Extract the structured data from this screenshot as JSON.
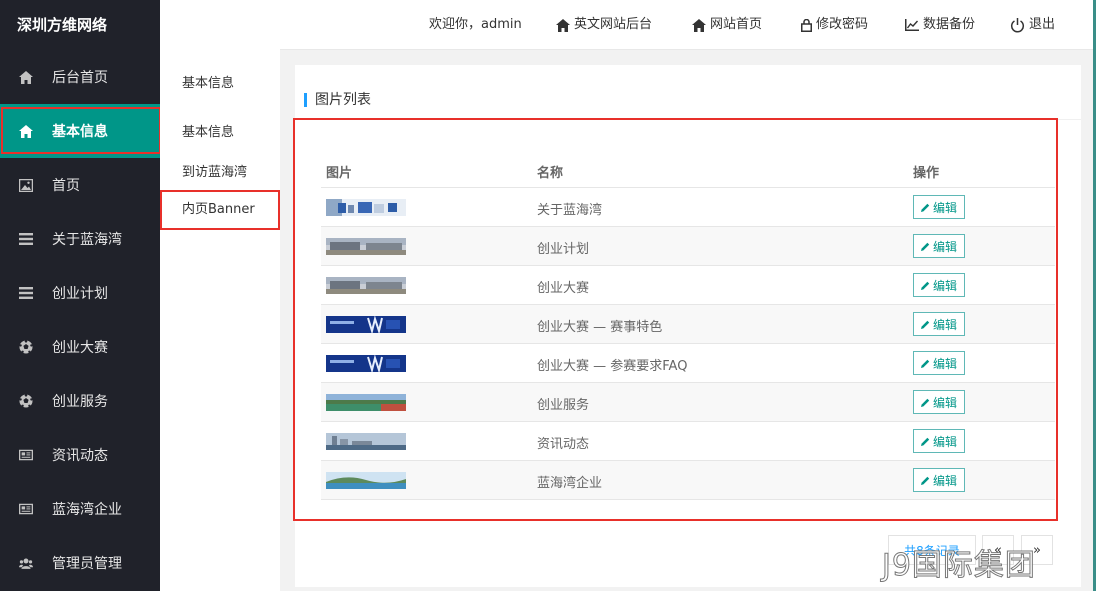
{
  "app": {
    "logo": "深圳方维网络"
  },
  "sidebar": {
    "items": [
      {
        "label": "后台首页",
        "icon": "home-icon"
      },
      {
        "label": "基本信息",
        "icon": "home-icon",
        "active": true
      },
      {
        "label": "首页",
        "icon": "picture-icon"
      },
      {
        "label": "关于蓝海湾",
        "icon": "menu-lines-icon"
      },
      {
        "label": "创业计划",
        "icon": "menu-lines-icon"
      },
      {
        "label": "创业大赛",
        "icon": "soccer-ball-icon"
      },
      {
        "label": "创业服务",
        "icon": "soccer-ball-icon"
      },
      {
        "label": "资讯动态",
        "icon": "newspaper-icon"
      },
      {
        "label": "蓝海湾企业",
        "icon": "newspaper-icon"
      },
      {
        "label": "管理员管理",
        "icon": "users-icon"
      }
    ]
  },
  "subnav": {
    "title": "基本信息",
    "items": [
      "基本信息",
      "到访蓝海湾",
      "内页Banner"
    ],
    "active_index": 2
  },
  "header": {
    "welcome": "欢迎你，admin",
    "links": {
      "english_admin": "英文网站后台",
      "site_home": "网站首页",
      "change_password": "修改密码",
      "data_backup": "数据备份",
      "logout": "退出"
    }
  },
  "panel": {
    "title": "图片列表"
  },
  "table": {
    "headers": {
      "image": "图片",
      "name": "名称",
      "action": "操作"
    },
    "edit_label": "编辑",
    "rows": [
      {
        "name": "关于蓝海湾",
        "thumb": "banner-about"
      },
      {
        "name": "创业计划",
        "thumb": "banner-campus"
      },
      {
        "name": "创业大赛",
        "thumb": "banner-campus"
      },
      {
        "name": "创业大赛 — 赛事特色",
        "thumb": "banner-blue"
      },
      {
        "name": "创业大赛 — 参赛要求FAQ",
        "thumb": "banner-blue"
      },
      {
        "name": "创业服务",
        "thumb": "banner-field"
      },
      {
        "name": "资讯动态",
        "thumb": "banner-city"
      },
      {
        "name": "蓝海湾企业",
        "thumb": "banner-coast"
      }
    ]
  },
  "pagination": {
    "info": "共8条记录",
    "prev": "«",
    "next": "»"
  },
  "watermark": "J9国际集团",
  "colors": {
    "sidebar_bg": "#20222a",
    "active": "#009688",
    "highlight": "#e8302a",
    "accent": "#1e9fff"
  }
}
